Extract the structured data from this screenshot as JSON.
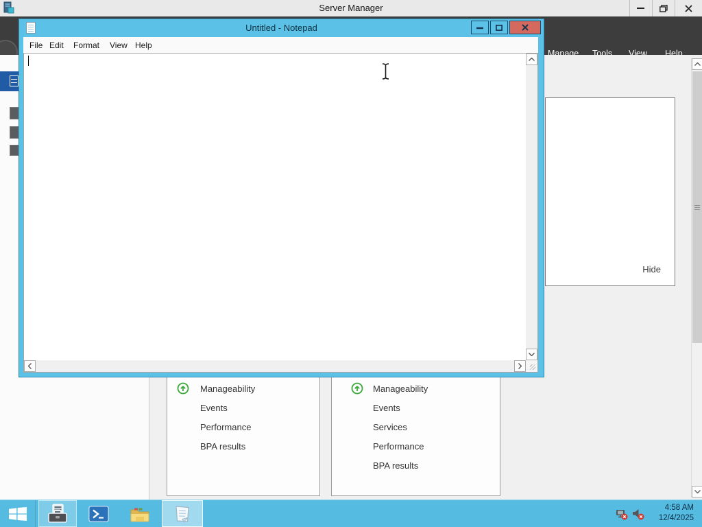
{
  "server_manager": {
    "title": "Server Manager",
    "nav_items": [
      "Manage",
      "Tools",
      "View",
      "Help"
    ],
    "flyout": {
      "hide": "Hide"
    },
    "tiles": [
      {
        "rows": [
          "Manageability",
          "Events",
          "Performance",
          "BPA results"
        ]
      },
      {
        "rows": [
          "Manageability",
          "Events",
          "Services",
          "Performance",
          "BPA results"
        ]
      }
    ]
  },
  "notepad": {
    "title": "Untitled - Notepad",
    "menu": [
      "File",
      "Edit",
      "Format",
      "View",
      "Help"
    ],
    "text": ""
  },
  "taskbar": {
    "clock": {
      "time": "4:58 AM",
      "date": "12/4/2025"
    }
  },
  "colors": {
    "accent_cyan": "#5cc1e6",
    "taskbar_cyan": "#55bbe0",
    "close_red": "#d4695e",
    "selected_blue": "#215ba5",
    "status_green": "#3aa83a",
    "navbar_dark": "#3d3d3d",
    "error_red": "#d13a30"
  }
}
